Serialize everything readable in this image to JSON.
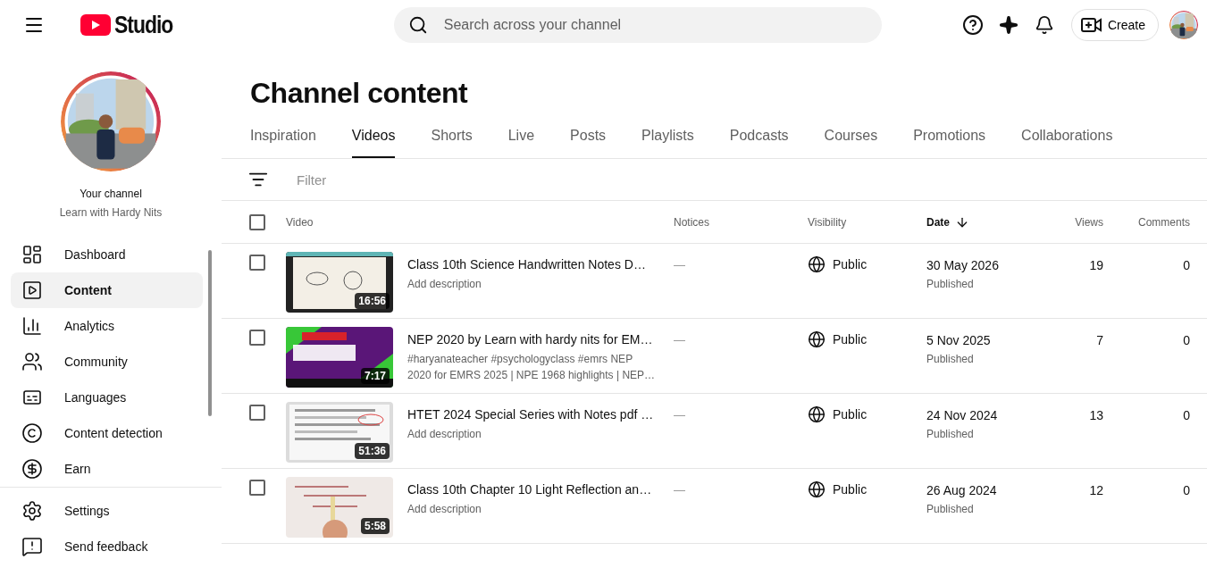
{
  "header": {
    "logo_text": "Studio",
    "search": {
      "placeholder": "Search across your channel"
    },
    "create_label": "Create"
  },
  "sidebar": {
    "channel_label": "Your channel",
    "channel_name": "Learn with Hardy Nits",
    "items": [
      {
        "label": "Dashboard",
        "selected": false
      },
      {
        "label": "Content",
        "selected": true
      },
      {
        "label": "Analytics",
        "selected": false
      },
      {
        "label": "Community",
        "selected": false
      },
      {
        "label": "Languages",
        "selected": false
      },
      {
        "label": "Content detection",
        "selected": false
      },
      {
        "label": "Earn",
        "selected": false
      }
    ],
    "footer_items": [
      {
        "label": "Settings",
        "selected": false
      },
      {
        "label": "Send feedback",
        "selected": false
      }
    ]
  },
  "page_title": "Channel content",
  "tabs": [
    {
      "label": "Inspiration",
      "selected": false
    },
    {
      "label": "Videos",
      "selected": true
    },
    {
      "label": "Shorts",
      "selected": false
    },
    {
      "label": "Live",
      "selected": false
    },
    {
      "label": "Posts",
      "selected": false
    },
    {
      "label": "Playlists",
      "selected": false
    },
    {
      "label": "Podcasts",
      "selected": false
    },
    {
      "label": "Courses",
      "selected": false
    },
    {
      "label": "Promotions",
      "selected": false
    },
    {
      "label": "Collaborations",
      "selected": false
    }
  ],
  "filter": {
    "placeholder": "Filter"
  },
  "table": {
    "select_all_checked": false,
    "columns": [
      {
        "label": "Video",
        "sorted": false
      },
      {
        "label": "Notices",
        "sorted": false
      },
      {
        "label": "Visibility",
        "sorted": false
      },
      {
        "label": "Date",
        "sorted": true
      },
      {
        "label": "Views",
        "sorted": false
      },
      {
        "label": "Comments",
        "sorted": false
      }
    ],
    "rows": [
      {
        "checked": false,
        "duration": "16:56",
        "title": "Class 10th Science Handwritten Notes D…",
        "description": "Add description",
        "notices": "—",
        "visibility": "Public",
        "date": "30 May 2026",
        "status": "Published",
        "views": "19",
        "comments": "0"
      },
      {
        "checked": false,
        "duration": "7:17",
        "title": "NEP 2020 by Learn with hardy nits for EM…",
        "description": "#haryanateacher #psychologyclass #emrs NEP 2020 for EMRS 2025 | NPE 1968 highlights | NEP…",
        "notices": "—",
        "visibility": "Public",
        "date": "5 Nov 2025",
        "status": "Published",
        "views": "7",
        "comments": "0"
      },
      {
        "checked": false,
        "duration": "51:36",
        "title": "HTET 2024 Special Series with Notes pdf …",
        "description": "Add description",
        "notices": "—",
        "visibility": "Public",
        "date": "24 Nov 2024",
        "status": "Published",
        "views": "13",
        "comments": "0"
      },
      {
        "checked": false,
        "duration": "5:58",
        "title": "Class 10th Chapter 10 Light Reflection an…",
        "description": "Add description",
        "notices": "—",
        "visibility": "Public",
        "date": "26 Aug 2024",
        "status": "Published",
        "views": "12",
        "comments": "0"
      }
    ]
  }
}
